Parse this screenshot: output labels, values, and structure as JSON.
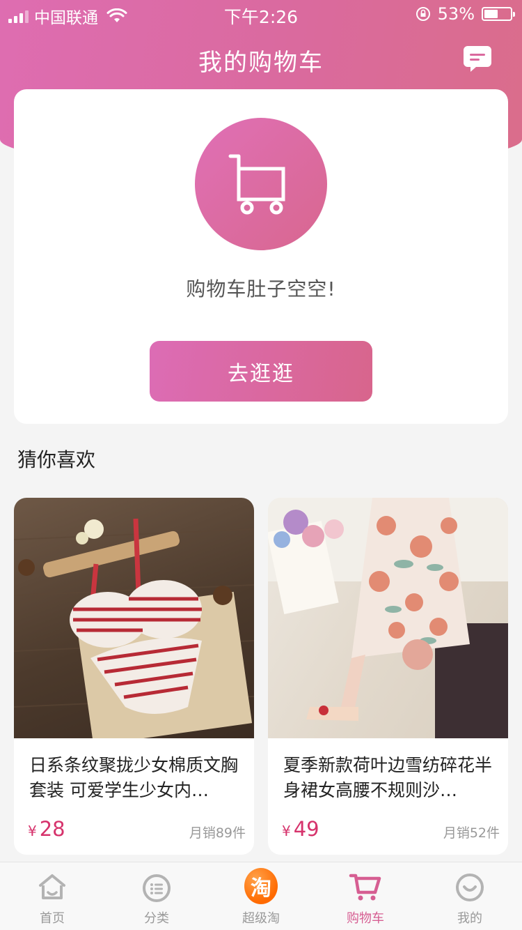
{
  "status_bar": {
    "carrier": "中国联通",
    "time": "下午2:26",
    "battery": "53%",
    "battery_level": 0.53
  },
  "header": {
    "title": "我的购物车"
  },
  "empty_cart": {
    "message": "购物车肚子空空!",
    "button_label": "去逛逛"
  },
  "recommend": {
    "title": "猜你喜欢",
    "products": [
      {
        "name": "日系条纹聚拢少女棉质文胸套装 可爱学生少女内…",
        "currency": "¥",
        "price": "28",
        "sales": "月销89件"
      },
      {
        "name": "夏季新款荷叶边雪纺碎花半身裙女高腰不规则沙…",
        "currency": "¥",
        "price": "49",
        "sales": "月销52件"
      }
    ]
  },
  "tabbar": {
    "items": [
      {
        "label": "首页",
        "icon": "home-icon"
      },
      {
        "label": "分类",
        "icon": "category-icon"
      },
      {
        "label": "超级淘",
        "icon": "taobao-icon",
        "badge_char": "淘"
      },
      {
        "label": "购物车",
        "icon": "cart-icon",
        "active": true
      },
      {
        "label": "我的",
        "icon": "profile-icon"
      }
    ]
  },
  "colors": {
    "brand_pink": "#da6a9e",
    "price": "#d6336c",
    "tab_active": "#d65e92"
  }
}
